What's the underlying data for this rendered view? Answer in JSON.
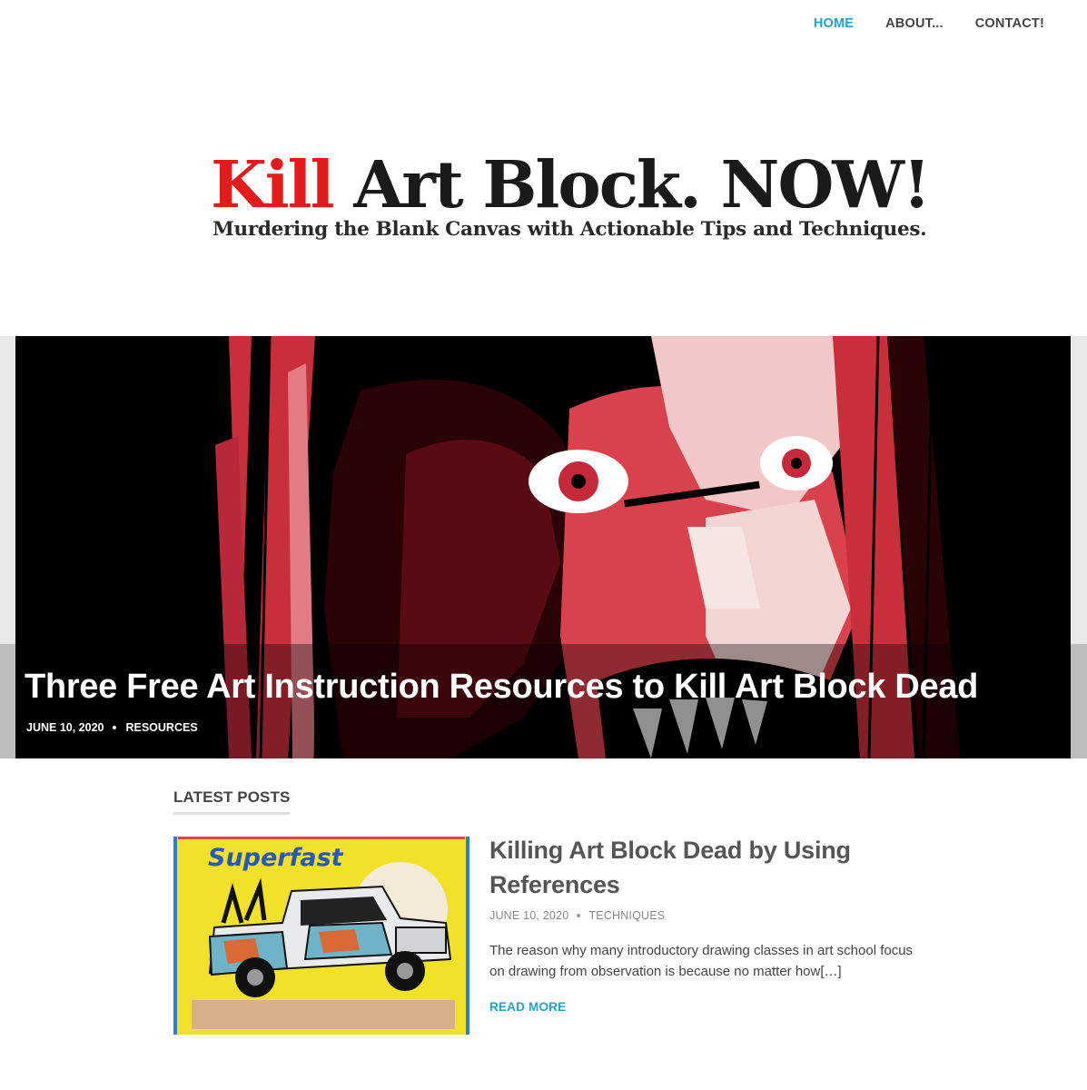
{
  "nav": {
    "items": [
      {
        "label": "HOME",
        "active": true
      },
      {
        "label": "ABOUT...",
        "active": false
      },
      {
        "label": "CONTACT!",
        "active": false
      }
    ]
  },
  "logo": {
    "kill": "Kill",
    "rest": " Art Block. NOW!",
    "tagline": "Murdering the Blank Canvas with Actionable Tips and Techniques."
  },
  "hero": {
    "title": "Three Free Art Instruction Resources to Kill Art Block Dead",
    "date": "JUNE 10, 2020",
    "category": "RESOURCES"
  },
  "latest": {
    "heading": "LATEST POSTS",
    "post": {
      "title": "Killing Art Block Dead by Using References",
      "date": "JUNE 10, 2020",
      "category": "TECHNIQUES",
      "excerpt": "The reason why many introductory drawing classes in art school focus on drawing from observation is because no matter how[…]",
      "read_more": "READ MORE",
      "thumb_text": "Superfast"
    }
  },
  "colors": {
    "accent": "#1fa3d6",
    "logo_red": "#e41b1b",
    "text": "#444444"
  }
}
